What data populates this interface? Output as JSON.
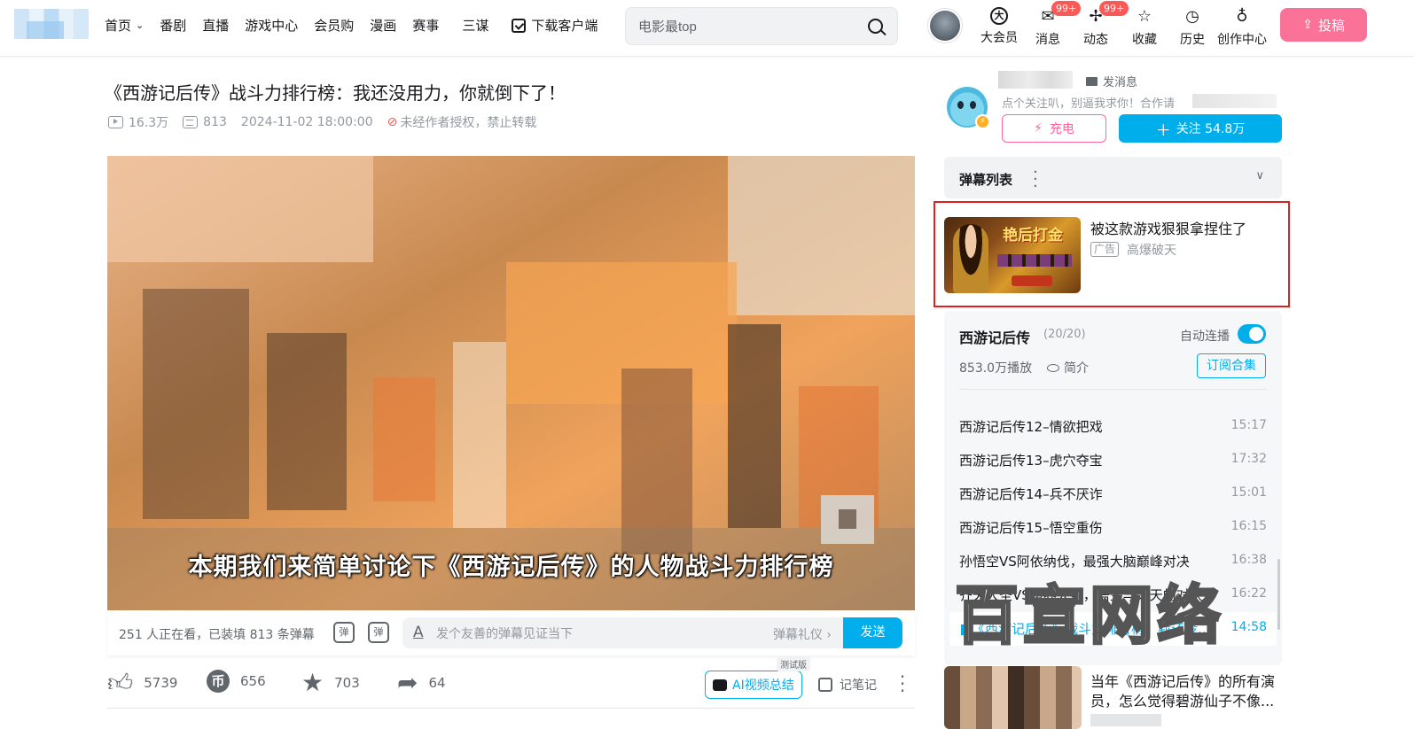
{
  "header": {
    "nav": [
      {
        "label": "首页",
        "has_dropdown": true
      },
      {
        "label": "番剧"
      },
      {
        "label": "直播"
      },
      {
        "label": "游戏中心"
      },
      {
        "label": "会员购"
      },
      {
        "label": "漫画"
      },
      {
        "label": "赛事"
      },
      {
        "label": "三谋"
      }
    ],
    "download_label": "下载客户端",
    "search_placeholder": "电影最top",
    "icons": [
      {
        "label": "大会员",
        "icon": "vip-icon"
      },
      {
        "label": "消息",
        "icon": "message-icon",
        "badge": "99+"
      },
      {
        "label": "动态",
        "icon": "dynamic-icon",
        "badge": "99+"
      },
      {
        "label": "收藏",
        "icon": "star-icon"
      },
      {
        "label": "历史",
        "icon": "clock-icon"
      },
      {
        "label": "创作中心",
        "icon": "lightbulb-icon"
      }
    ],
    "upload_label": "投稿",
    "accent_color": "#fb7299"
  },
  "video": {
    "title": "《西游记后传》战斗力排行榜：我还没用力，你就倒下了！",
    "views": "16.3万",
    "danmaku_count": "813",
    "publish_time": "2024-11-02 18:00:00",
    "copyright_notice": "未经作者授权，禁止转载",
    "subtitle": "本期我们来简单讨论下《西游记后传》的人物战斗力排行榜"
  },
  "danmaku_bar": {
    "viewers_text": "251 人正在看，已装填 813 条弹幕",
    "toggle_label": "弹",
    "input_placeholder": "发个友善的弹幕见证当下",
    "etiquette_label": "弹幕礼仪 ›",
    "send_label": "发送"
  },
  "actions": {
    "like": "5739",
    "coin": "656",
    "favorite": "703",
    "share": "64",
    "ai_summary_label": "AI视频总结",
    "beta_label": "测试版",
    "notes_label": "记笔记"
  },
  "uploader": {
    "message_label": "发消息",
    "desc": "点个关注叭，别逼我求你！合作请",
    "charge_label": "充电",
    "follow_label": "关注 54.8万"
  },
  "danmaku_list": {
    "title": "弹幕列表"
  },
  "ad": {
    "title": "被这款游戏狠狠拿捏住了",
    "tag": "广告",
    "source": "高爆破天",
    "thumb_text": "艳后打金"
  },
  "collection": {
    "title": "西游记后传",
    "count": "(20/20)",
    "autoplay_label": "自动连播",
    "autoplay_on": true,
    "plays": "853.0万播放",
    "intro_label": "简介",
    "subscribe_label": "订阅合集",
    "episodes": [
      {
        "title": "西游记后传12–情欲把戏",
        "duration": "15:17"
      },
      {
        "title": "西游记后传13–虎穴夺宝",
        "duration": "17:32"
      },
      {
        "title": "西游记后传14–兵不厌诈",
        "duration": "15:01"
      },
      {
        "title": "西游记后传15–悟空重伤",
        "duration": "16:15"
      },
      {
        "title": "孙悟空VS阿依纳伐，最强大脑巅峰对决",
        "duration": "16:38"
      },
      {
        "title": "齐天大圣VS魔界大圣，悟空与无天的对决",
        "duration": "16:22"
      },
      {
        "title": "《西游记后传》战斗力排行榜，我还没用力",
        "duration": "14:58",
        "active": true
      }
    ]
  },
  "watermark": "百宣网络",
  "recommend": {
    "title": "当年《西游记后传》的所有演员，怎么觉得碧游仙子不像..."
  }
}
